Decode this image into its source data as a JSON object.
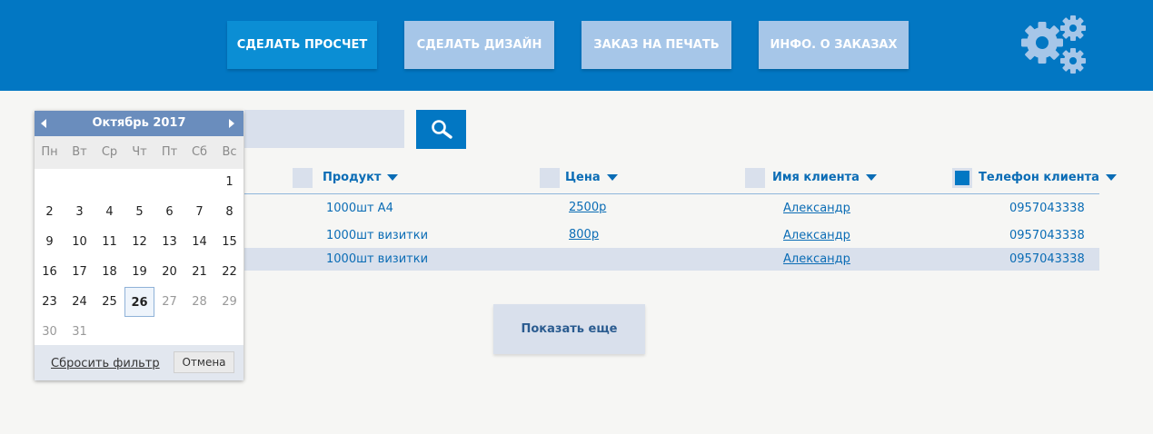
{
  "header": {
    "nav": [
      {
        "label": "СДЕЛАТЬ ПРОСЧЕТ",
        "active": true
      },
      {
        "label": "СДЕЛАТЬ ДИЗАЙН",
        "active": false
      },
      {
        "label": "ЗАКАЗ НА ПЕЧАТЬ",
        "active": false
      },
      {
        "label": "ИНФО. О ЗАКАЗАХ",
        "active": false
      }
    ],
    "settings_icon": "gears-icon"
  },
  "search": {
    "value": "",
    "icon": "search-icon"
  },
  "table": {
    "columns": [
      {
        "label": "Продукт",
        "checked": false
      },
      {
        "label": "Цена",
        "checked": false
      },
      {
        "label": "Имя клиента",
        "checked": false
      },
      {
        "label": "Телефон клиента",
        "checked": true
      }
    ],
    "rows": [
      {
        "product": "1000шт А4",
        "price": "2500р",
        "client": "Александр",
        "phone": "0957043338"
      },
      {
        "product": "1000шт визитки",
        "price": "800р",
        "client": "Александр",
        "phone": "0957043338"
      },
      {
        "product": "1000шт визитки",
        "price": "",
        "client": "Александр",
        "phone": "0957043338"
      }
    ]
  },
  "show_more": "Показать еще",
  "calendar": {
    "title": "Октябрь 2017",
    "weekdays": [
      "Пн",
      "Вт",
      "Ср",
      "Чт",
      "Пт",
      "Сб",
      "Вс"
    ],
    "days": [
      "1",
      "2",
      "3",
      "4",
      "5",
      "6",
      "7",
      "8",
      "9",
      "10",
      "11",
      "12",
      "13",
      "14",
      "15",
      "16",
      "17",
      "18",
      "19",
      "20",
      "21",
      "22",
      "23",
      "24",
      "25",
      "26",
      "27",
      "28",
      "29",
      "30",
      "31"
    ],
    "selected_day": "26",
    "reset_label": "Сбросить фильтр",
    "cancel_label": "Отмена"
  },
  "colors": {
    "header_bg": "#0277c3",
    "nav_active": "#0b8ed4",
    "nav_inactive": "#a6c6e8",
    "link": "#0a6cb5",
    "highlight_row": "#d9e0ec"
  }
}
